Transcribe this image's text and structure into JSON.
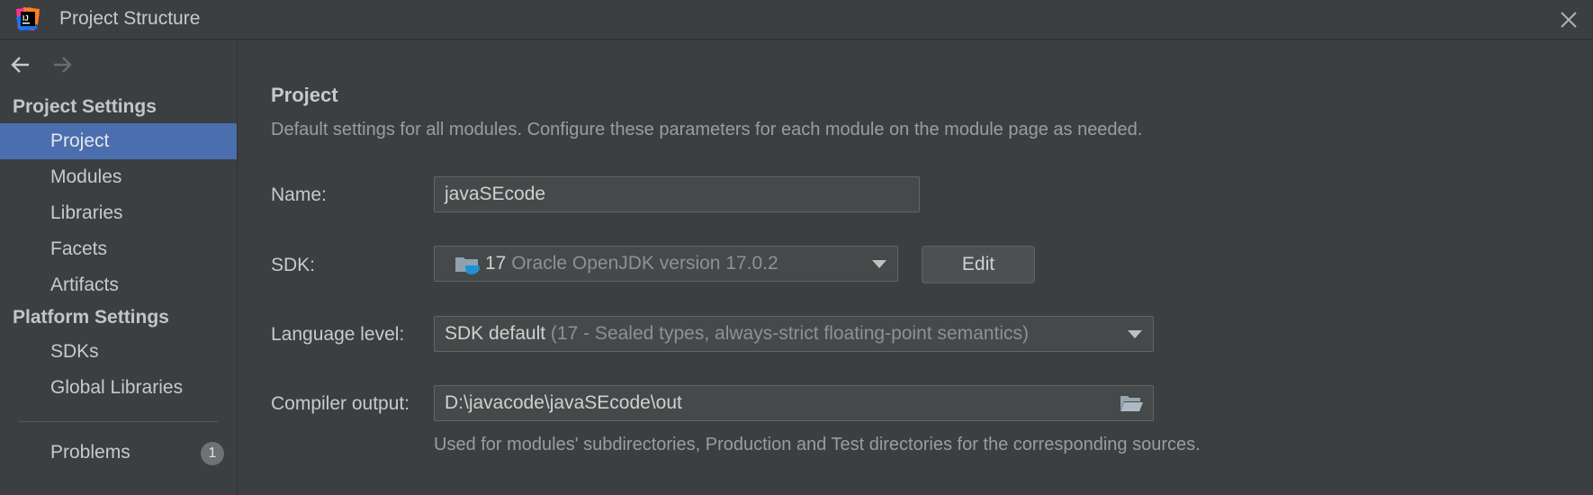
{
  "window": {
    "title": "Project Structure",
    "logo_text": "IJ"
  },
  "icons": {
    "app": "intellij-logo-icon",
    "close": "close-icon",
    "back": "arrow-left-icon",
    "forward": "arrow-right-icon",
    "sdk": "jdk-folder-icon",
    "dropdown": "chevron-down-icon",
    "folder": "folder-open-icon"
  },
  "colors": {
    "background": "#3c3f41",
    "selection": "#4b6eaf",
    "field": "#45494a",
    "sdk_icon": "#1e90d6"
  },
  "sidebar": {
    "project_settings_header": "Project Settings",
    "project_settings_items": [
      {
        "label": "Project"
      },
      {
        "label": "Modules"
      },
      {
        "label": "Libraries"
      },
      {
        "label": "Facets"
      },
      {
        "label": "Artifacts"
      }
    ],
    "platform_settings_header": "Platform Settings",
    "platform_settings_items": [
      {
        "label": "SDKs"
      },
      {
        "label": "Global Libraries"
      }
    ],
    "problems": {
      "label": "Problems",
      "count": "1"
    },
    "selected": "Project"
  },
  "main": {
    "heading": "Project",
    "description": "Default settings for all modules. Configure these parameters for each module on the module page as needed.",
    "name": {
      "label": "Name:",
      "value": "javaSEcode"
    },
    "sdk": {
      "label": "SDK:",
      "version": "17",
      "detail": "Oracle OpenJDK version 17.0.2",
      "edit_label": "Edit"
    },
    "language_level": {
      "label": "Language level:",
      "value": "SDK default",
      "detail": "(17 - Sealed types, always-strict floating-point semantics)"
    },
    "compiler_output": {
      "label": "Compiler output:",
      "value": "D:\\javacode\\javaSEcode\\out",
      "hint": "Used for modules' subdirectories, Production and Test directories for the corresponding sources."
    }
  }
}
